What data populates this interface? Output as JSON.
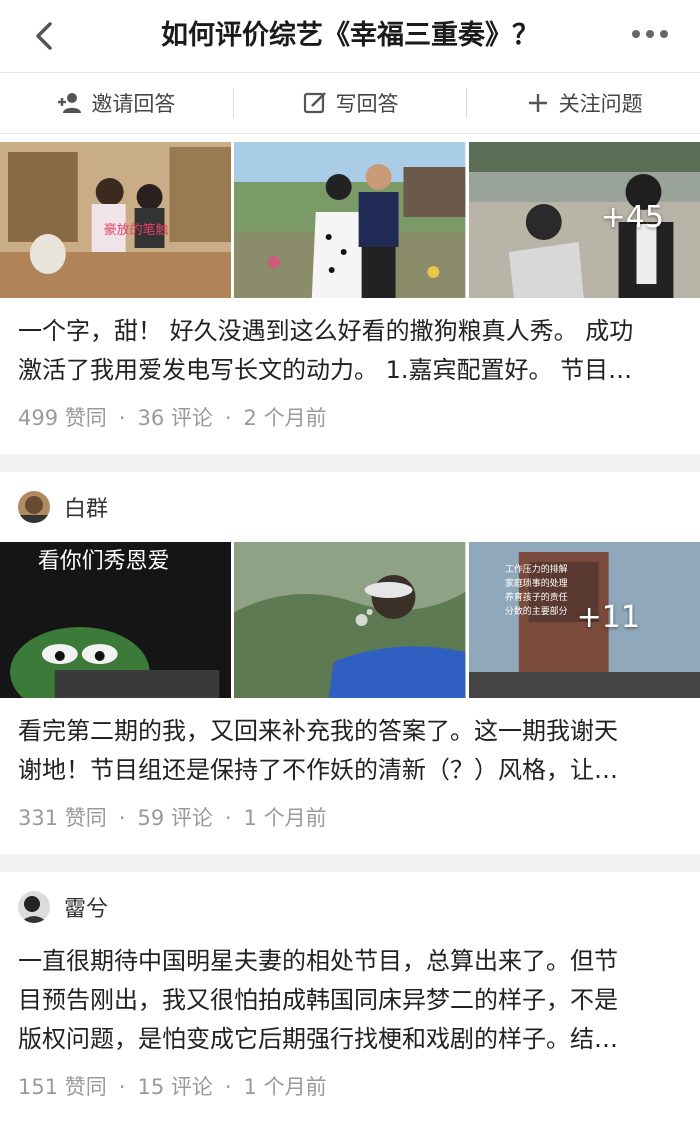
{
  "header": {
    "title": "如何评价综艺《幸福三重奏》？",
    "back_icon": "chevron-left-icon",
    "more_icon": "more-dots-icon"
  },
  "actions": [
    {
      "label": "邀请回答",
      "icon": "invite-user-icon"
    },
    {
      "label": "写回答",
      "icon": "edit-icon"
    },
    {
      "label": "关注问题",
      "icon": "plus-icon"
    }
  ],
  "answers": [
    {
      "author": "",
      "images_more": "+45",
      "image_caption": "豪放的笔触",
      "excerpt_line1": "一个字，甜！ 好久没遇到这么好看的撒狗粮真人秀。 成功",
      "excerpt_line2": "激活了我用爱发电写长文的动力。 1.嘉宾配置好。 节目…",
      "likes": "499 赞同",
      "comments": "36 评论",
      "time": "2 个月前"
    },
    {
      "author": "白群",
      "images_more": "+11",
      "image_caption": "看你们秀恩爱",
      "excerpt_line1": "看完第二期的我，又回来补充我的答案了。这一期我谢天",
      "excerpt_line2": "谢地！节目组还是保持了不作妖的清新（？）风格，让…",
      "likes": "331 赞同",
      "comments": "59 评论",
      "time": "1 个月前"
    },
    {
      "author": "霤兮",
      "excerpt_line1": "一直很期待中国明星夫妻的相处节目，总算出来了。但节",
      "excerpt_line2": "目预告刚出，我又很怕拍成韩国同床异梦二的样子，不是",
      "excerpt_line3": "版权问题，是怕变成它后期强行找梗和戏剧的样子。结…",
      "likes": "151 赞同",
      "comments": "15 评论",
      "time": "1 个月前"
    }
  ],
  "separator": "·"
}
